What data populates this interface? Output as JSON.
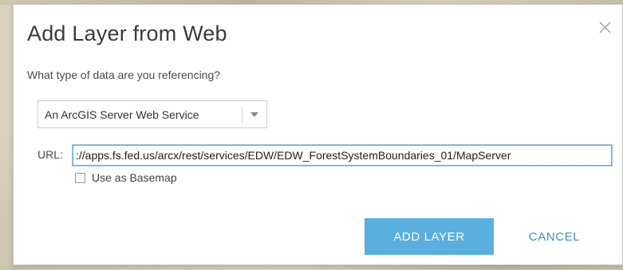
{
  "dialog": {
    "title": "Add Layer from Web",
    "close_icon": "close-icon",
    "question": "What type of data are you referencing?",
    "data_type": {
      "selected": "An ArcGIS Server Web Service",
      "arrow_icon": "chevron-down-icon"
    },
    "url": {
      "label": "URL:",
      "value": "://apps.fs.fed.us/arcx/rest/services/EDW/EDW_ForestSystemBoundaries_01/MapServer"
    },
    "basemap": {
      "label": "Use as Basemap",
      "checked": false
    },
    "buttons": {
      "add": "ADD LAYER",
      "cancel": "CANCEL"
    },
    "colors": {
      "primary": "#5aaee0",
      "link": "#3f8fc8",
      "input_focus": "#7aa6d9"
    }
  }
}
